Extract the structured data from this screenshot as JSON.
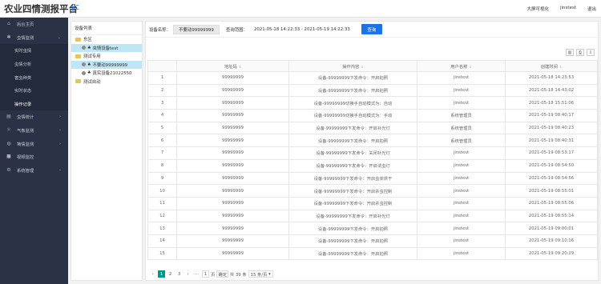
{
  "app": {
    "title": "农业四情测报平台"
  },
  "topbar": {
    "links": [
      "大屏可视化",
      "jinstest",
      "退出"
    ]
  },
  "sidebar": {
    "items": [
      {
        "label": "后台主页",
        "icon": "home-icon",
        "arrow": ""
      },
      {
        "label": "虫情监测",
        "icon": "bug-icon",
        "arrow": "⌄"
      }
    ],
    "subitems": [
      "实时虫情",
      "虫情分析",
      "害虫种类",
      "实时状态",
      "操作记录"
    ],
    "items2": [
      {
        "label": "虫情统计",
        "icon": "stats-icon",
        "arrow": "›"
      },
      {
        "label": "气象监测",
        "icon": "weather-icon",
        "arrow": "›"
      },
      {
        "label": "墒情监测",
        "icon": "soil-icon",
        "arrow": "›"
      },
      {
        "label": "视频监控",
        "icon": "video-icon",
        "arrow": ""
      },
      {
        "label": "系统管理",
        "icon": "gear-icon",
        "arrow": "›"
      }
    ]
  },
  "tree": {
    "title": "设备列表",
    "nodes": [
      {
        "label": "东区",
        "type": "folder",
        "level": 0
      },
      {
        "label": "虫情设备test",
        "type": "device",
        "level": 1,
        "selected": true
      },
      {
        "label": "测试专用",
        "type": "folder",
        "level": 0
      },
      {
        "label": "不要动99999999",
        "type": "device",
        "level": 1,
        "selected": true
      },
      {
        "label": "真实设备21022550",
        "type": "device",
        "level": 1,
        "selected": false
      },
      {
        "label": "测试自动",
        "type": "folder",
        "level": 0
      }
    ]
  },
  "filter": {
    "device_label": "设备名称：",
    "device_value": "不要动99999999",
    "range_label": "查询范围：",
    "range_value": "2021-05-18 14:22:33 - 2021-05-19 14:22:33",
    "query_button": "查询"
  },
  "toolbar_icons": [
    "columns-icon",
    "print-icon",
    "export-icon"
  ],
  "table": {
    "headers": [
      "",
      "地址码",
      "操作内容",
      "用户名称",
      "创建时间"
    ],
    "rows": [
      [
        "1",
        "99999999",
        "设备-99999999下发命令：开启拍照",
        "jinstest",
        "2021-05-18 14:23:53"
      ],
      [
        "2",
        "99999999",
        "设备-99999999下发命令：开启拍照",
        "jinstest",
        "2021-05-18 14:43:02"
      ],
      [
        "3",
        "99999999",
        "设备-99999999切换手自动模式为：自动",
        "jinstest",
        "2021-05-18 15:51:06"
      ],
      [
        "4",
        "99999999",
        "设备-99999999切换手自动模式为：手动",
        "系统管理员",
        "2021-05-19 08:40:17"
      ],
      [
        "5",
        "99999999",
        "设备-99999999下发命令：开启补光灯",
        "系统管理员",
        "2021-05-19 08:40:23"
      ],
      [
        "6",
        "99999999",
        "设备-99999999下发命令：开启拍照",
        "系统管理员",
        "2021-05-19 08:40:31"
      ],
      [
        "7",
        "99999999",
        "设备-99999999下发命令：关闭补光灯",
        "jinstest",
        "2021-05-19 08:53:17"
      ],
      [
        "8",
        "99999999",
        "设备-99999999下发命令：开启诱虫灯",
        "jinstest",
        "2021-05-19 08:54:50"
      ],
      [
        "9",
        "99999999",
        "设备-99999999下发命令：开启虫体烘干",
        "jinstest",
        "2021-05-19 08:54:56"
      ],
      [
        "10",
        "99999999",
        "设备-99999999下发命令：开启杀虫控制",
        "jinstest",
        "2021-05-19 08:55:01"
      ],
      [
        "11",
        "99999999",
        "设备-99999999下发命令：开启杀虫控制",
        "jinstest",
        "2021-05-19 08:55:06"
      ],
      [
        "12",
        "99999999",
        "设备-99999999下发命令：开启补光灯",
        "jinstest",
        "2021-05-19 08:55:14"
      ],
      [
        "13",
        "99999999",
        "设备-99999999下发命令：开启拍照",
        "jinstest",
        "2021-05-19 09:00:01"
      ],
      [
        "14",
        "99999999",
        "设备-99999999下发命令：开启拍照",
        "jinstest",
        "2021-05-19 09:10:16"
      ],
      [
        "15",
        "99999999",
        "设备-99999999下发命令：开启拍照",
        "jinstest",
        "2021-05-19 09:20:29"
      ]
    ]
  },
  "pager": {
    "prev": "‹",
    "pages": [
      "1",
      "2",
      "3"
    ],
    "current": "1",
    "next": "›",
    "ellipsis": "⋯",
    "goto_value": "1",
    "goto_unit": "页",
    "confirm": "确定",
    "total": "共 39 条",
    "page_size": "15 条/页"
  }
}
